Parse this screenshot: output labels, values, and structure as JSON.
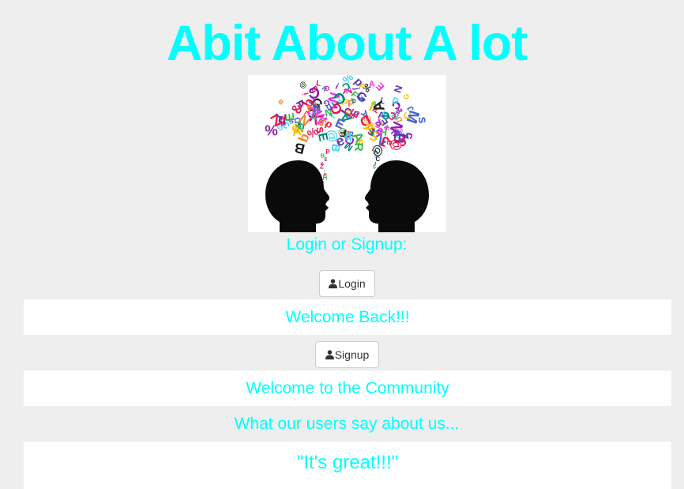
{
  "header": {
    "title": "Abit About A lot"
  },
  "hero": {
    "icon": "two-heads-talking-letters-illustration"
  },
  "login_section": {
    "prompt": "Login or Signup:",
    "login_label": "Login",
    "login_message": "Welcome Back!!!",
    "signup_label": "Signup",
    "signup_message": "Welcome to the Community"
  },
  "testimonials": {
    "heading": "What our users say about us...",
    "quote": "\"It's great!!!\""
  },
  "colors": {
    "accent": "#00ffff",
    "background": "#eeeeee",
    "panel": "#ffffff",
    "button_border": "#cccccc",
    "button_text": "#333333"
  }
}
